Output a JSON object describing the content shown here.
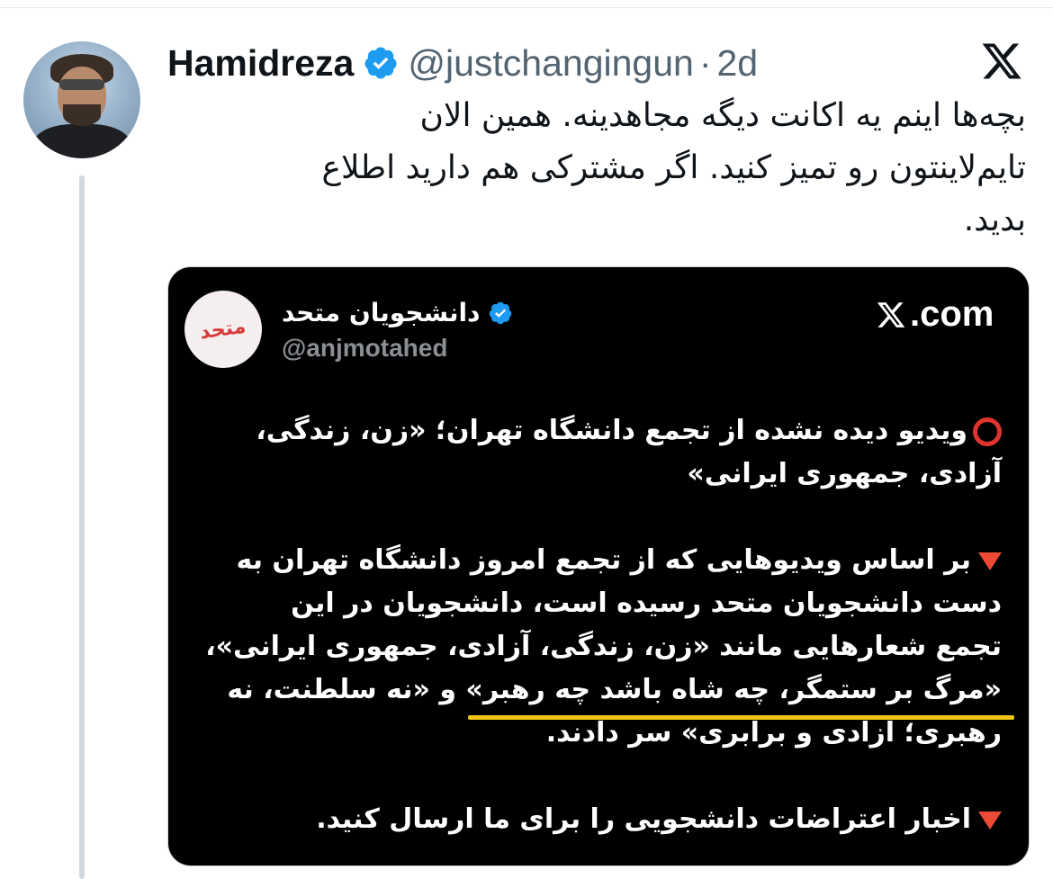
{
  "tweet": {
    "display_name": "Hamidreza",
    "handle": "@justchangingun",
    "separator": "·",
    "time": "2d",
    "text_lines": [
      "بچه‌ها اینم یه اکانت دیگه مجاهدینه. همین الان",
      "تایم‌لاینتون رو تمیز کنید. اگر مشترکی هم دارید اطلاع",
      "بدید."
    ]
  },
  "icons": {
    "verified": "verified-badge-icon",
    "platform": "x-logo-icon",
    "brand_color": "#1d9bf0"
  },
  "embedded_card": {
    "account_name": "دانشجویان متحد",
    "account_handle": "@anjmotahed",
    "logo_text": "متحد",
    "domain_text": ".com",
    "paragraph1": [
      "ویدیو دیده نشده از تجمع دانشگاه تهران؛ «زن، زندگی،",
      "آزادی، جمهوری ایرانی»"
    ],
    "paragraph2": [
      "بر اساس ویدیوهایی که از تجمع امروز دانشگاه تهران به",
      "دست دانشجویان متحد رسیده است، دانشجویان در این",
      "تجمع شعارهایی مانند «زن، زندگی، آزادی، جمهوری ایرانی»،",
      "«مرگ بر ستمگر، چه شاه باشد چه رهبر» و «نه سلطنت، نه",
      "رهبری؛ آزادی و برابری» سر دادند."
    ],
    "paragraph3": [
      "اخبار اعتراضات دانشجویی را برای ما ارسال کنید."
    ],
    "colors": {
      "background": "#000000",
      "highlight": "#f1c40f",
      "marker_red": "#e0332d"
    }
  }
}
